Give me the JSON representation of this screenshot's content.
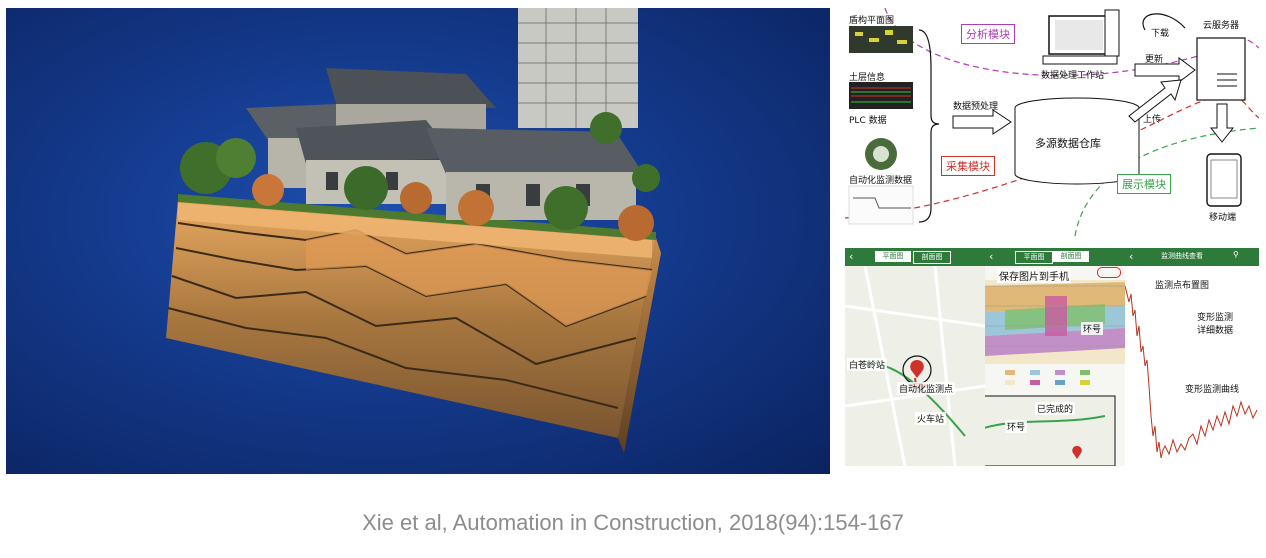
{
  "colors": {
    "background_blue": "#143a8c",
    "analysis_purple": "#b03ab8",
    "collect_red": "#d0302a",
    "display_green": "#3aa24a",
    "app_bar_green": "#2d7a3b",
    "caption_gray": "#8c8c8c"
  },
  "diagram": {
    "inputs": [
      "盾构平面图",
      "土层信息",
      "PLC 数据",
      "自动化监测数据"
    ],
    "preprocess": "数据预处理",
    "warehouse": "多源数据仓库",
    "workstation": "数据处理工作站",
    "cloud": "云服务器",
    "mobile": "移动端",
    "download": "下载",
    "update": "更新",
    "upload": "上传",
    "analysis_module": "分析模块",
    "collect_module": "采集模块",
    "display_module": "展示模块"
  },
  "app": {
    "tab_plan": "平面图",
    "tab_section": "剖面图",
    "tab_plan2": "平面图",
    "tab_section2": "剖面图",
    "curve_title": "监测曲线查看",
    "save_image": "保存图片到手机",
    "ring": "环号",
    "baicangling": "白苍岭站",
    "auto_point": "自动化监测点",
    "train_station": "火车站",
    "completed": "已完成的",
    "ring2": "环号",
    "point_layout": "监测点布置图",
    "deform_detail": "变形监测\n详细数据",
    "deform_curve": "变形监测曲线"
  },
  "caption": "Xie et al, Automation in Construction, 2018(94):154-167"
}
